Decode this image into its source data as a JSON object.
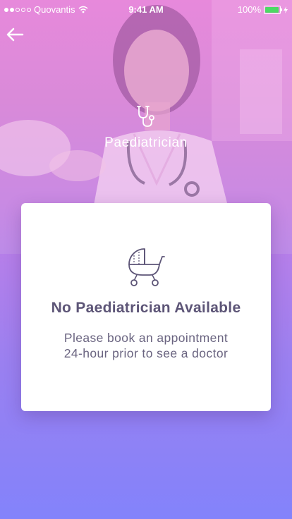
{
  "status_bar": {
    "carrier": "Quovantis",
    "time": "9:41 AM",
    "battery": "100%",
    "signal_bars_filled": 2,
    "signal_bars_total": 5
  },
  "header": {
    "back_icon": "back-arrow-icon",
    "specialty_icon": "stethoscope-icon",
    "specialty": "Paediatrician"
  },
  "empty_state": {
    "icon": "baby-stroller-icon",
    "title": "No Paediatrician Available",
    "message_line1": "Please book an appointment",
    "message_line2": "24-hour prior to see a doctor"
  },
  "colors": {
    "gradient_top": "#e789db",
    "gradient_bottom": "#8383fb",
    "title_text": "#5d5577",
    "battery_fill": "#4cd964"
  }
}
